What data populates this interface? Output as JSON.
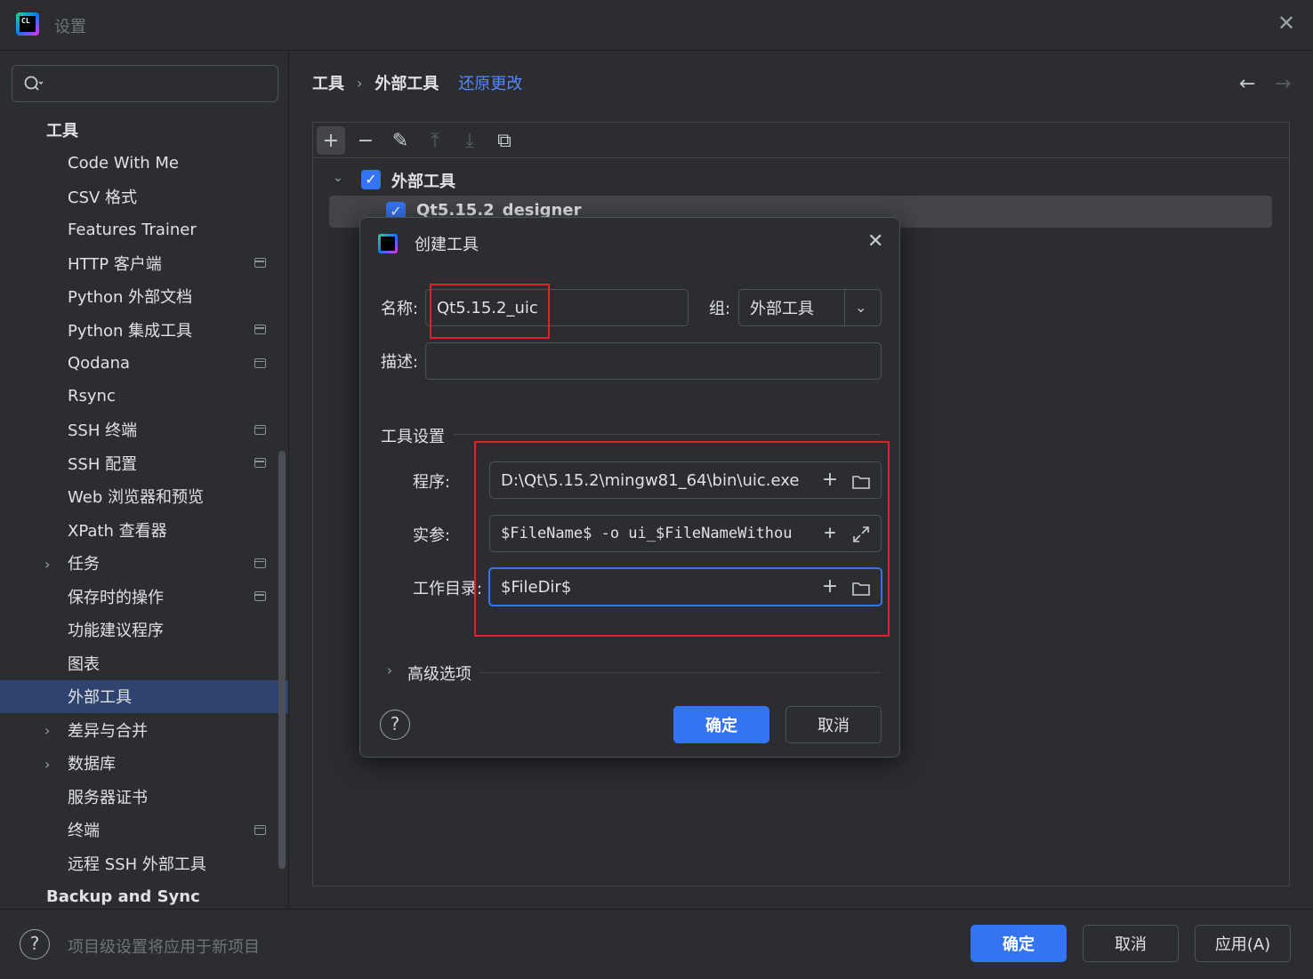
{
  "window": {
    "title": "设置"
  },
  "search": {
    "placeholder": ""
  },
  "sidebar": {
    "items": [
      {
        "label": "工具",
        "top": true
      },
      {
        "label": "Code With Me"
      },
      {
        "label": "CSV 格式"
      },
      {
        "label": "Features Trainer"
      },
      {
        "label": "HTTP 客户端",
        "project": true
      },
      {
        "label": "Python 外部文档"
      },
      {
        "label": "Python 集成工具",
        "project": true
      },
      {
        "label": "Qodana",
        "project": true
      },
      {
        "label": "Rsync"
      },
      {
        "label": "SSH 终端",
        "project": true
      },
      {
        "label": "SSH 配置",
        "project": true
      },
      {
        "label": "Web 浏览器和预览"
      },
      {
        "label": "XPath 查看器"
      },
      {
        "label": "任务",
        "expandable": true,
        "project": true
      },
      {
        "label": "保存时的操作",
        "project": true
      },
      {
        "label": "功能建议程序"
      },
      {
        "label": "图表"
      },
      {
        "label": "外部工具",
        "selected": true
      },
      {
        "label": "差异与合并",
        "expandable": true
      },
      {
        "label": "数据库",
        "expandable": true
      },
      {
        "label": "服务器证书"
      },
      {
        "label": "终端",
        "project": true
      },
      {
        "label": "远程 SSH 外部工具"
      },
      {
        "label": "Backup and Sync",
        "top": true
      }
    ]
  },
  "breadcrumb": {
    "parent": "工具",
    "current": "外部工具",
    "revert": "还原更改"
  },
  "toolbar": {
    "add": "+",
    "remove": "−",
    "edit": "✎",
    "up": "⤒",
    "down": "⤓",
    "copy": "⧉"
  },
  "tree": {
    "group": "外部工具",
    "item": "Qt5.15.2_designer"
  },
  "dialog": {
    "title": "创建工具",
    "name_label": "名称:",
    "name_value": "Qt5.15.2_uic",
    "group_label": "组:",
    "group_value": "外部工具",
    "desc_label": "描述:",
    "desc_value": "",
    "section_title": "工具设置",
    "program_label": "程序:",
    "program_value": "D:\\Qt\\5.15.2\\mingw81_64\\bin\\uic.exe",
    "args_label": "实参:",
    "args_value": "$FileName$ -o ui_$FileNameWithou",
    "workdir_label": "工作目录:",
    "workdir_value": "$FileDir$",
    "advanced_label": "高级选项",
    "ok": "确定",
    "cancel": "取消",
    "help": "?"
  },
  "footer": {
    "help": "?",
    "hint": "项目级设置将应用于新项目",
    "ok": "确定",
    "cancel": "取消",
    "apply": "应用(A)"
  },
  "colors": {
    "accent": "#3574f0",
    "link": "#548af7",
    "highlight": "#e0202a",
    "selected_bg": "#2e436e"
  }
}
